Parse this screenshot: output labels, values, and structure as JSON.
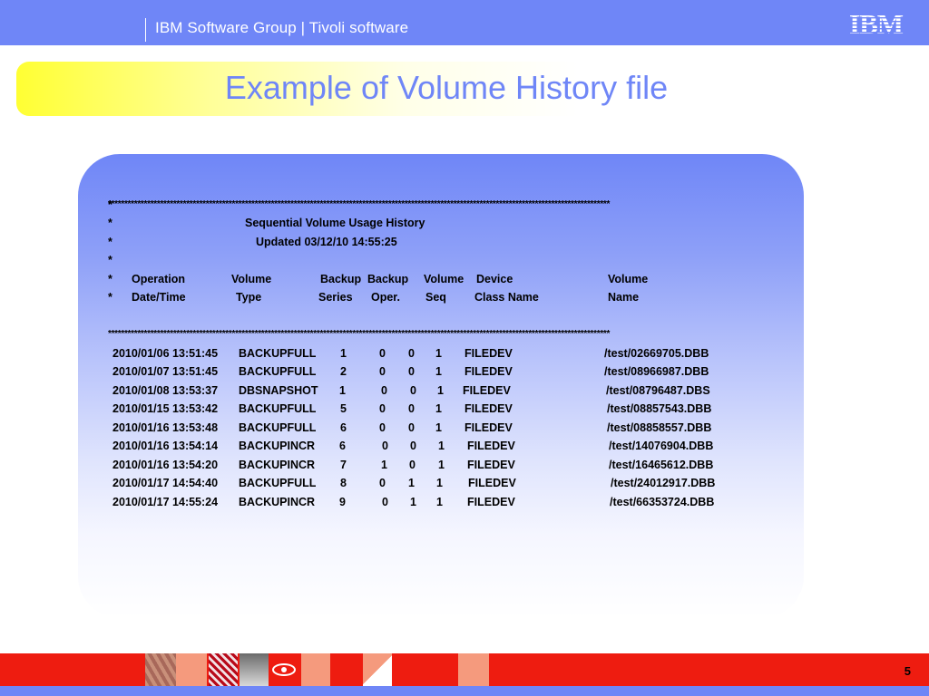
{
  "header": {
    "text": "IBM Software Group | Tivoli software",
    "logo": "IBM"
  },
  "title": "Example of Volume History file",
  "content": {
    "stars_top": "**********************************************************************************************************************************************************",
    "asterisk": "*",
    "heading1": "Sequential Volume Usage History",
    "heading2": "Updated 03/12/10 14:55:25",
    "col_headers_row1": [
      "Operation",
      "Volume",
      "Backup",
      "Backup",
      "Volume",
      "Device",
      "Volume"
    ],
    "col_headers_row2": [
      "Date/Time",
      "Type",
      "Series",
      "Oper.",
      "Seq",
      "Class Name",
      "Name"
    ],
    "stars_bottom": "**********************************************************************************************************************************************************",
    "rows": [
      {
        "datetime": "2010/01/06 13:51:45",
        "type": "BACKUPFULL",
        "series": "1",
        "oper": "0",
        "a": "0",
        "seq": "1",
        "device": "FILEDEV",
        "name": "/test/02669705.DBB"
      },
      {
        "datetime": "2010/01/07 13:51:45",
        "type": "BACKUPFULL",
        "series": "2",
        "oper": "0",
        "a": "0",
        "seq": "1",
        "device": "FILEDEV",
        "name": "/test/08966987.DBB"
      },
      {
        "datetime": "2010/01/08 13:53:37",
        "type": "DBSNAPSHOT",
        "series": "1",
        "oper": "0",
        "a": "0",
        "seq": "1",
        "device": "FILEDEV",
        "name": "/test/08796487.DBS"
      },
      {
        "datetime": "2010/01/15 13:53:42",
        "type": "BACKUPFULL",
        "series": "5",
        "oper": "0",
        "a": "0",
        "seq": "1",
        "device": "FILEDEV",
        "name": "/test/08857543.DBB"
      },
      {
        "datetime": "2010/01/16 13:53:48",
        "type": "BACKUPFULL",
        "series": "6",
        "oper": "0",
        "a": "0",
        "seq": "1",
        "device": "FILEDEV",
        "name": "/test/08858557.DBB"
      },
      {
        "datetime": "2010/01/16 13:54:14",
        "type": "BACKUPINCR",
        "series": "6",
        "oper": "0",
        "a": "0",
        "seq": "1",
        "device": "FILEDEV",
        "name": "/test/14076904.DBB"
      },
      {
        "datetime": "2010/01/16 13:54:20",
        "type": "BACKUPINCR",
        "series": "7",
        "oper": "1",
        "a": "0",
        "seq": "1",
        "device": "FILEDEV",
        "name": "/test/16465612.DBB"
      },
      {
        "datetime": "2010/01/17 14:54:40",
        "type": "BACKUPFULL",
        "series": "8",
        "oper": "0",
        "a": "1",
        "seq": "1",
        "device": "FILEDEV",
        "name": "/test/24012917.DBB"
      },
      {
        "datetime": "2010/01/17 14:55:24",
        "type": "BACKUPINCR",
        "series": "9",
        "oper": "0",
        "a": "1",
        "seq": "1",
        "device": "FILEDEV",
        "name": "/test/66353724.DBB"
      }
    ]
  },
  "footer": {
    "page_number": "5"
  },
  "colors": {
    "brand_blue": "#6f86f7",
    "footer_red": "#ee1c10",
    "title_yellow": "#ffff33"
  }
}
